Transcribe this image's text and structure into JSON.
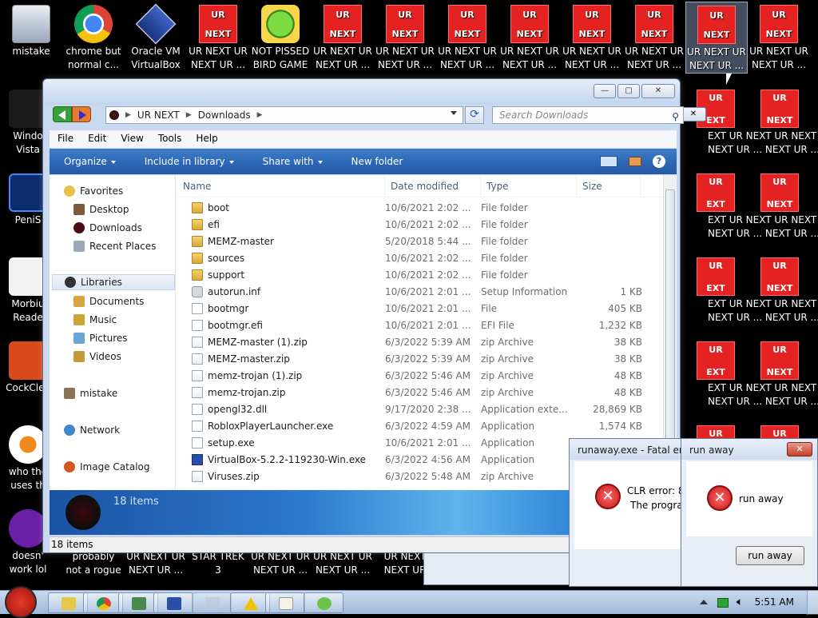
{
  "desktop": {
    "top_icons": [
      {
        "line1": "mistake",
        "line2": "",
        "kind": "mistake"
      },
      {
        "line1": "chrome but",
        "line2": "normal c...",
        "kind": "chrome"
      },
      {
        "line1": "Oracle VM",
        "line2": "VirtualBox",
        "kind": "vbox"
      },
      {
        "line1": "UR NEXT UR",
        "line2": "NEXT UR ...",
        "kind": "ur"
      },
      {
        "line1": "NOT PISSED",
        "line2": "BIRD GAME",
        "kind": "bird"
      },
      {
        "line1": "UR NEXT UR",
        "line2": "NEXT UR ...",
        "kind": "ur"
      },
      {
        "line1": "UR NEXT UR",
        "line2": "NEXT UR ...",
        "kind": "ur"
      },
      {
        "line1": "UR NEXT UR",
        "line2": "NEXT UR ...",
        "kind": "ur"
      },
      {
        "line1": "UR NEXT UR",
        "line2": "NEXT UR ...",
        "kind": "ur"
      },
      {
        "line1": "UR NEXT UR",
        "line2": "NEXT UR ...",
        "kind": "ur"
      },
      {
        "line1": "UR NEXT UR",
        "line2": "NEXT UR ...",
        "kind": "ur"
      },
      {
        "line1": "UR NEXT UR",
        "line2": "NEXT UR ...",
        "kind": "ur"
      },
      {
        "line1": "UR NEXT UR",
        "line2": "NEXT UR ...",
        "kind": "ur"
      }
    ],
    "tile_text": {
      "top": "UR",
      "bottom": "NEXT"
    },
    "left_icons": [
      {
        "line1": "Windo",
        "line2": "Vista"
      },
      {
        "line1": "PeniS",
        "line2": ""
      },
      {
        "line1": "Morbiu",
        "line2": "Reade"
      },
      {
        "line1": "CockClea",
        "line2": ""
      },
      {
        "line1": "who the",
        "line2": "uses th"
      },
      {
        "line1": "doesn'",
        "line2": "work lol"
      }
    ],
    "bottom_labels": [
      {
        "line1": "probably",
        "line2": "not a rogue"
      },
      {
        "line1": "UR NEXT UR",
        "line2": "NEXT UR ..."
      },
      {
        "line1": "STAR TREK",
        "line2": "3"
      },
      {
        "line1": "UR NEXT UR",
        "line2": "NEXT UR ..."
      },
      {
        "line1": "UR NEXT UR",
        "line2": "NEXT UR ..."
      },
      {
        "line1": "UR NEXT",
        "line2": "NEXT UR"
      }
    ],
    "right_strip_text": {
      "line1": "EXT UR NEXT UR NEXT UR U",
      "line2": "NEXT UR ... NEXT UR ... N"
    },
    "right_tile_text": {
      "a": "UR",
      "b": "EXT",
      "c": "UR",
      "d": "NEXT"
    }
  },
  "explorer": {
    "caption": {
      "minimize": "—",
      "maximize": "▢",
      "close": "✕"
    },
    "breadcrumb": [
      "UR NEXT",
      "Downloads"
    ],
    "search_placeholder": "Search Downloads",
    "menu": [
      "File",
      "Edit",
      "View",
      "Tools",
      "Help"
    ],
    "commands": [
      "Organize",
      "Include in library",
      "Share with",
      "New folder"
    ],
    "nav": {
      "favorites": "Favorites",
      "favorites_items": [
        "Desktop",
        "Downloads",
        "Recent Places"
      ],
      "libraries": "Libraries",
      "libraries_items": [
        "Documents",
        "Music",
        "Pictures",
        "Videos"
      ],
      "user": "mistake",
      "network": "Network",
      "catalog": "Image Catalog"
    },
    "columns": [
      "Name",
      "Date modified",
      "Type",
      "Size"
    ],
    "files": [
      {
        "name": "boot",
        "date": "10/6/2021 2:02 ...",
        "type": "File folder",
        "size": "",
        "icon": "folder"
      },
      {
        "name": "efi",
        "date": "10/6/2021 2:02 ...",
        "type": "File folder",
        "size": "",
        "icon": "folder"
      },
      {
        "name": "MEMZ-master",
        "date": "5/20/2018 5:44 ...",
        "type": "File folder",
        "size": "",
        "icon": "folder"
      },
      {
        "name": "sources",
        "date": "10/6/2021 2:02 ...",
        "type": "File folder",
        "size": "",
        "icon": "folder"
      },
      {
        "name": "support",
        "date": "10/6/2021 2:02 ...",
        "type": "File folder",
        "size": "",
        "icon": "folder"
      },
      {
        "name": "autorun.inf",
        "date": "10/6/2021 2:01 ...",
        "type": "Setup Information",
        "size": "1 KB",
        "icon": "gear"
      },
      {
        "name": "bootmgr",
        "date": "10/6/2021 2:01 ...",
        "type": "File",
        "size": "405 KB",
        "icon": "file"
      },
      {
        "name": "bootmgr.efi",
        "date": "10/6/2021 2:01 ...",
        "type": "EFI File",
        "size": "1,232 KB",
        "icon": "file"
      },
      {
        "name": "MEMZ-master (1).zip",
        "date": "6/3/2022 5:39 AM",
        "type": "zip Archive",
        "size": "38 KB",
        "icon": "zip"
      },
      {
        "name": "MEMZ-master.zip",
        "date": "6/3/2022 5:39 AM",
        "type": "zip Archive",
        "size": "38 KB",
        "icon": "zip"
      },
      {
        "name": "memz-trojan (1).zip",
        "date": "6/3/2022 5:46 AM",
        "type": "zip Archive",
        "size": "48 KB",
        "icon": "zip"
      },
      {
        "name": "memz-trojan.zip",
        "date": "6/3/2022 5:46 AM",
        "type": "zip Archive",
        "size": "48 KB",
        "icon": "zip"
      },
      {
        "name": "opengl32.dll",
        "date": "9/17/2020 2:38 ...",
        "type": "Application exte...",
        "size": "28,869 KB",
        "icon": "file"
      },
      {
        "name": "RobloxPlayerLauncher.exe",
        "date": "6/3/2022 4:59 AM",
        "type": "Application",
        "size": "1,574 KB",
        "icon": "file"
      },
      {
        "name": "setup.exe",
        "date": "10/6/2021 2:01 ...",
        "type": "Application",
        "size": "",
        "icon": "file"
      },
      {
        "name": "VirtualBox-5.2.2-119230-Win.exe",
        "date": "6/3/2022 4:56 AM",
        "type": "Application",
        "size": "",
        "icon": "vbox"
      },
      {
        "name": "Viruses.zip",
        "date": "6/3/2022 5:48 AM",
        "type": "zip Archive",
        "size": "",
        "icon": "zip"
      }
    ],
    "details_count": "18 items",
    "status_count": "18 items"
  },
  "dialog_fatal": {
    "title": "runaway.exe - Fatal err",
    "line1": "CLR error: 8",
    "line2": "The progra"
  },
  "dialog_runaway": {
    "title": "run away",
    "message": "run away",
    "button": "run away",
    "close": "✕"
  },
  "taskbar": {
    "clock": "5:51 AM"
  },
  "colors": {
    "ur_red": "#e52222",
    "command_bar": "#2d69b8",
    "desktop": "#000000"
  }
}
